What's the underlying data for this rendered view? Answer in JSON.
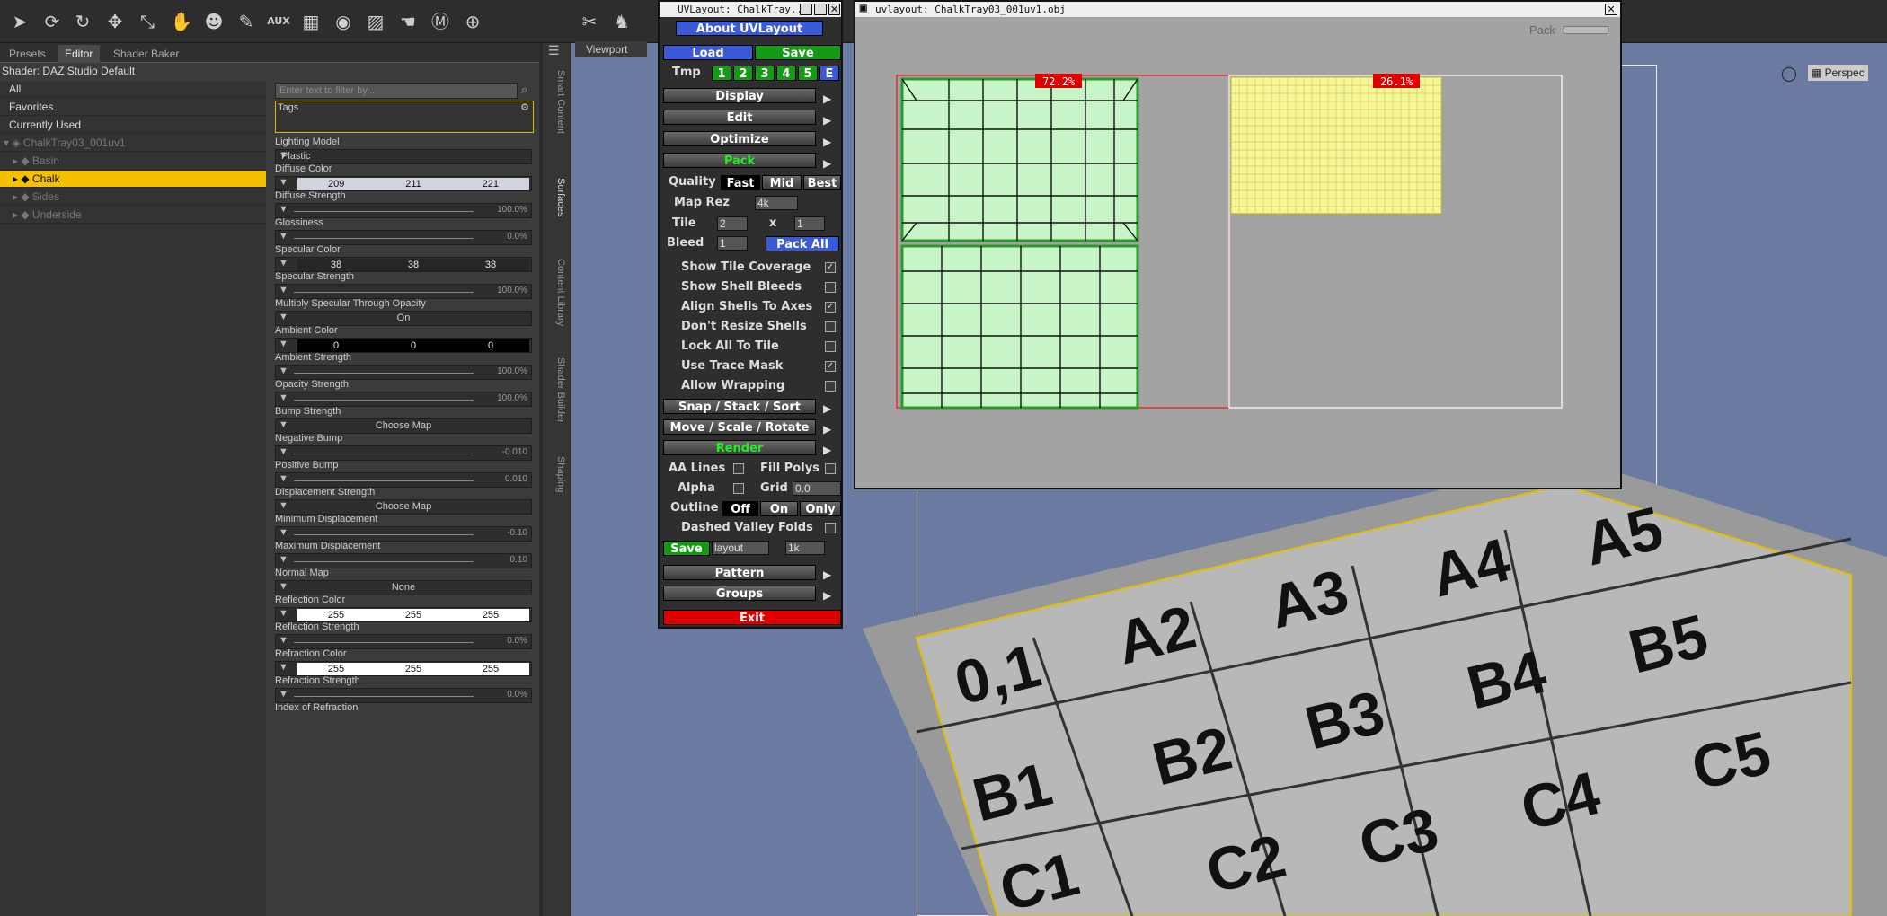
{
  "toolbar": {
    "icons": [
      "arrow-select",
      "orbit",
      "rotate",
      "move",
      "scale",
      "active-pose",
      "figure",
      "joint",
      "aux",
      "geometry-edit",
      "render",
      "node-weight",
      "hand-pose",
      "shape",
      "universal"
    ],
    "aux_label": "AUX"
  },
  "left_panel": {
    "tabs": [
      "Presets",
      "Editor",
      "Shader Baker"
    ],
    "active_tab": "Editor",
    "shader_line": "Shader: DAZ Studio Default",
    "filters": [
      "All",
      "Favorites",
      "Currently Used"
    ],
    "tree": {
      "root": "ChalkTray03_001uv1",
      "items": [
        "Basin",
        "Chalk",
        "Sides",
        "Underside"
      ],
      "selected": "Chalk"
    },
    "search_placeholder": "Enter text to filter by...",
    "tags_label": "Tags",
    "properties": [
      {
        "label": "Lighting Model",
        "kind": "dropdown",
        "value": "Plastic"
      },
      {
        "label": "Diffuse Color",
        "kind": "color",
        "values": [
          "209",
          "211",
          "221"
        ],
        "bg": "#d1d3dd"
      },
      {
        "label": "Diffuse Strength",
        "kind": "slider",
        "value": "100.0%"
      },
      {
        "label": "Glossiness",
        "kind": "slider",
        "value": "0.0%"
      },
      {
        "label": "Specular Color",
        "kind": "color",
        "values": [
          "38",
          "38",
          "38"
        ],
        "bg": "#262626"
      },
      {
        "label": "Specular Strength",
        "kind": "slider",
        "value": "100.0%"
      },
      {
        "label": "Multiply Specular Through Opacity",
        "kind": "toggle",
        "value": "On"
      },
      {
        "label": "Ambient Color",
        "kind": "color",
        "values": [
          "0",
          "0",
          "0"
        ],
        "bg": "#000000"
      },
      {
        "label": "Ambient Strength",
        "kind": "slider",
        "value": "100.0%"
      },
      {
        "label": "Opacity Strength",
        "kind": "slider",
        "value": "100.0%"
      },
      {
        "label": "Bump Strength",
        "kind": "map",
        "value": "Choose Map"
      },
      {
        "label": "Negative Bump",
        "kind": "slider",
        "value": "-0.010"
      },
      {
        "label": "Positive Bump",
        "kind": "slider",
        "value": "0.010"
      },
      {
        "label": "Displacement Strength",
        "kind": "map",
        "value": "Choose Map"
      },
      {
        "label": "Minimum Displacement",
        "kind": "slider",
        "value": "-0.10"
      },
      {
        "label": "Maximum Displacement",
        "kind": "slider",
        "value": "0.10"
      },
      {
        "label": "Normal Map",
        "kind": "map",
        "value": "None"
      },
      {
        "label": "Reflection Color",
        "kind": "color",
        "values": [
          "255",
          "255",
          "255"
        ],
        "bg": "#ffffff"
      },
      {
        "label": "Reflection Strength",
        "kind": "slider",
        "value": "0.0%"
      },
      {
        "label": "Refraction Color",
        "kind": "color",
        "values": [
          "255",
          "255",
          "255"
        ],
        "bg": "#ffffff"
      },
      {
        "label": "Refraction Strength",
        "kind": "slider",
        "value": "0.0%"
      },
      {
        "label": "Index of Refraction",
        "kind": "label"
      }
    ],
    "side_tabs": [
      "Smart Content",
      "Surfaces",
      "Content Library",
      "Shader Builder",
      "Shaping"
    ]
  },
  "viewport": {
    "tab": "Viewport",
    "camera": "Perspec",
    "grid_labels": {
      "row_a": [
        "0,1",
        "A2",
        "A3",
        "A4",
        "A5"
      ],
      "row_b": [
        "B1",
        "B2",
        "B3",
        "B4",
        "B5"
      ],
      "row_c": [
        "C1",
        "C2",
        "C3",
        "C4",
        "C5"
      ]
    }
  },
  "uv_control": {
    "title": "UVLayout: ChalkTray...",
    "about": "About UVLayout",
    "load": "Load",
    "save": "Save",
    "tmp_label": "Tmp",
    "tmp_slots": [
      "1",
      "2",
      "3",
      "4",
      "5",
      "E"
    ],
    "menus": [
      "Display",
      "Edit",
      "Optimize",
      "Pack"
    ],
    "quality_label": "Quality",
    "quality_options": [
      "Fast",
      "Mid",
      "Best"
    ],
    "map_rez_label": "Map Rez",
    "map_rez_value": "4k",
    "tile_label": "Tile",
    "tile_x": "2",
    "tile_sep": "x",
    "tile_y": "1",
    "bleed_label": "Bleed",
    "bleed_value": "1",
    "pack_all": "Pack All",
    "options": [
      {
        "label": "Show Tile Coverage",
        "checked": true
      },
      {
        "label": "Show Shell Bleeds",
        "checked": false
      },
      {
        "label": "Align Shells To Axes",
        "checked": true
      },
      {
        "label": "Don't Resize Shells",
        "checked": false
      },
      {
        "label": "Lock All To Tile",
        "checked": false
      },
      {
        "label": "Use Trace Mask",
        "checked": true
      },
      {
        "label": "Allow Wrapping",
        "checked": false
      }
    ],
    "menus2": [
      "Snap / Stack / Sort",
      "Move / Scale / Rotate",
      "Render"
    ],
    "aa_lines": "AA Lines",
    "fill_polys": "Fill Polys",
    "alpha": "Alpha",
    "grid_label": "Grid",
    "grid_value": "0.0",
    "outline_label": "Outline",
    "outline_options": [
      "Off",
      "On",
      "Only"
    ],
    "dashed_valley": "Dashed Valley Folds",
    "save_btn": "Save",
    "save_name": "layout",
    "save_res": "1k",
    "menus3": [
      "Pattern",
      "Groups"
    ],
    "exit": "Exit"
  },
  "uv_window": {
    "title": "uvlayout: ChalkTray03_001uv1.obj",
    "pack_label": "Pack",
    "tile1_coverage": "72.2%",
    "tile2_coverage": "26.1%"
  },
  "colors": {
    "accent": "#f5c000",
    "blue_btn": "#3a5ad8",
    "green_btn": "#149a14",
    "exit_red": "#e00000",
    "uv_green": "#c8f5c8",
    "uv_yellow": "#f5f59a",
    "coverage_red": "#e00000"
  }
}
